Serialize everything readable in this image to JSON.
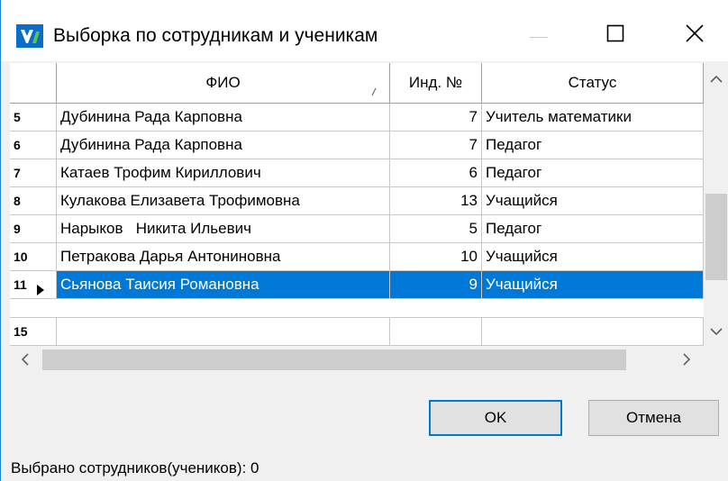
{
  "window": {
    "title": "Выборка по сотрудникам и ученикам"
  },
  "grid": {
    "columns": [
      {
        "label": "ФИО"
      },
      {
        "label": "Инд. №"
      },
      {
        "label": "Статус"
      }
    ],
    "rows": [
      {
        "num": "5",
        "fio": "Дубинина Рада Карповна",
        "ind": "7",
        "status": "Учитель математики",
        "selected": false
      },
      {
        "num": "6",
        "fio": "Дубинина Рада Карповна",
        "ind": "7",
        "status": "Педагог",
        "selected": false
      },
      {
        "num": "7",
        "fio": "Катаев Трофим Кириллович",
        "ind": "6",
        "status": "Педагог",
        "selected": false
      },
      {
        "num": "8",
        "fio": "Кулакова Елизавета Трофимовна",
        "ind": "13",
        "status": "Учащийся",
        "selected": false
      },
      {
        "num": "9",
        "fio": "Нарыков   Никита Ильевич",
        "ind": "5",
        "status": "Педагог",
        "selected": false
      },
      {
        "num": "10",
        "fio": "Петракова Дарья Антониновна",
        "ind": "10",
        "status": "Учащийся",
        "selected": false
      },
      {
        "num": "11",
        "fio": "Сьянова Таисия Романовна",
        "ind": "9",
        "status": "Учащийся",
        "selected": true
      }
    ],
    "new_row": {
      "num": "15"
    }
  },
  "buttons": {
    "ok": "OK",
    "cancel": "Отмена"
  },
  "status": {
    "text": "Выбрано сотрудников(учеников): 0"
  },
  "colors": {
    "selection": "#0078d7",
    "window_border": "#1883d7",
    "icon_blue": "#0a6ec8",
    "icon_green": "#5fc24a"
  }
}
